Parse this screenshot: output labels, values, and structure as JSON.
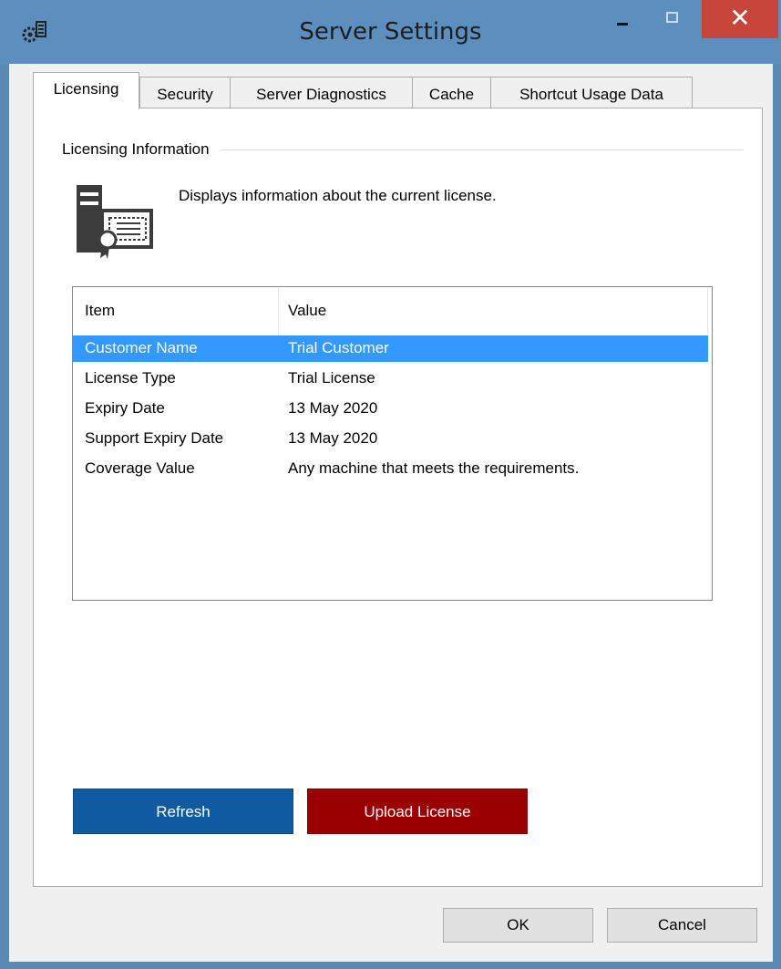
{
  "window": {
    "title": "Server Settings",
    "close_glyph": "✕",
    "icons": [
      "app-settings-icon",
      "minimize-icon",
      "maximize-icon",
      "close-icon"
    ]
  },
  "tabs": [
    {
      "label": "Licensing",
      "active": true
    },
    {
      "label": "Security",
      "active": false
    },
    {
      "label": "Server Diagnostics",
      "active": false
    },
    {
      "label": "Cache",
      "active": false
    },
    {
      "label": "Shortcut Usage Data",
      "active": false
    }
  ],
  "licensing": {
    "group_title": "Licensing Information",
    "description": "Displays information about the current license.",
    "icon": "license-certificate-icon",
    "table": {
      "columns": [
        "Item",
        "Value"
      ],
      "rows": [
        {
          "item": "Customer Name",
          "value": "Trial Customer",
          "selected": true
        },
        {
          "item": "License Type",
          "value": "Trial License",
          "selected": false
        },
        {
          "item": "Expiry Date",
          "value": "13 May 2020",
          "selected": false
        },
        {
          "item": "Support Expiry Date",
          "value": "13 May 2020",
          "selected": false
        },
        {
          "item": "Coverage Value",
          "value": "Any machine that meets the requirements.",
          "selected": false
        }
      ]
    },
    "refresh_label": "Refresh",
    "upload_label": "Upload License"
  },
  "footer": {
    "ok_label": "OK",
    "cancel_label": "Cancel"
  },
  "colors": {
    "titlebar": "#5d8fbe",
    "close_button": "#c7453a",
    "selection": "#3399ff",
    "refresh_button": "#0f5aa0",
    "upload_button": "#9a0000"
  }
}
